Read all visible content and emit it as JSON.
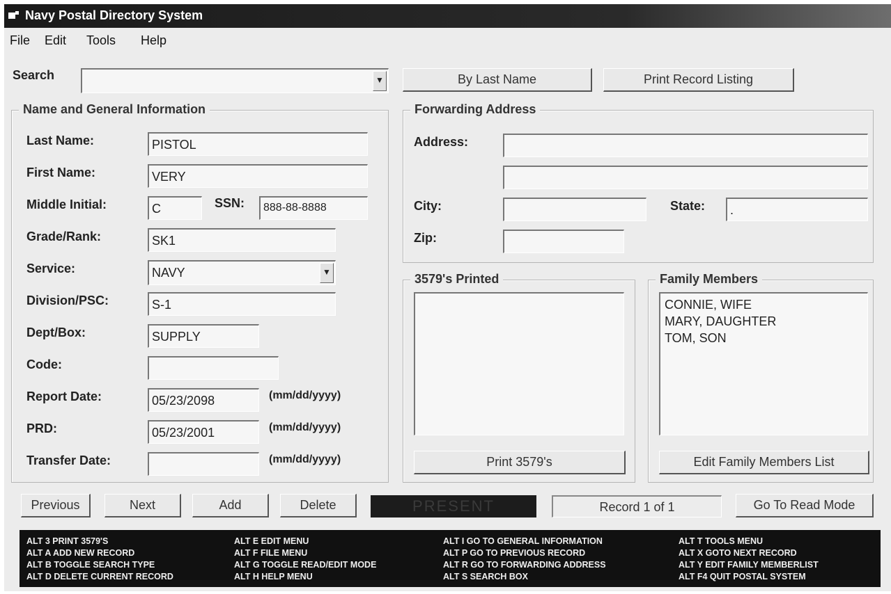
{
  "window": {
    "title": "Navy Postal Directory System"
  },
  "menu": {
    "file": "File",
    "edit": "Edit",
    "tools": "Tools",
    "help": "Help"
  },
  "search": {
    "label": "Search",
    "value": "",
    "by_last_name": "By Last Name",
    "print_listing": "Print Record Listing"
  },
  "general": {
    "title": "Name and General Information",
    "last_name_label": "Last Name:",
    "last_name": "PISTOL",
    "first_name_label": "First Name:",
    "first_name": "VERY",
    "middle_initial_label": "Middle Initial:",
    "middle_initial": "C",
    "ssn_label": "SSN:",
    "ssn": "888-88-8888",
    "grade_label": "Grade/Rank:",
    "grade": "SK1",
    "service_label": "Service:",
    "service": "NAVY",
    "division_label": "Division/PSC:",
    "division": "S-1",
    "dept_label": "Dept/Box:",
    "dept": "SUPPLY",
    "code_label": "Code:",
    "code": "",
    "report_date_label": "Report Date:",
    "report_date": "05/23/2098",
    "prd_label": "PRD:",
    "prd": "05/23/2001",
    "transfer_date_label": "Transfer Date:",
    "transfer_date": "",
    "date_format": "(mm/dd/yyyy)"
  },
  "forwarding": {
    "title": "Forwarding Address",
    "address_label": "Address:",
    "address1": "",
    "address2": "",
    "city_label": "City:",
    "city": "",
    "state_label": "State:",
    "state": ".",
    "zip_label": "Zip:",
    "zip": ""
  },
  "printed": {
    "title": "3579's Printed",
    "items": [],
    "button": "Print 3579's"
  },
  "family": {
    "title": "Family Members",
    "items": [
      "CONNIE, WIFE",
      "MARY, DAUGHTER",
      "TOM, SON"
    ],
    "button": "Edit Family Members List"
  },
  "nav": {
    "previous": "Previous",
    "next": "Next",
    "add": "Add",
    "delete": "Delete",
    "present": "PRESENT",
    "record": "Record 1 of 1",
    "read_mode": "Go To Read Mode"
  },
  "shortcuts": [
    [
      "ALT 3  PRINT 3579'S",
      "ALT A  ADD NEW RECORD",
      "ALT B  TOGGLE SEARCH TYPE",
      "ALT D  DELETE CURRENT RECORD"
    ],
    [
      "ALT E  EDIT MENU",
      "ALT F  FILE MENU",
      "ALT G  TOGGLE READ/EDIT MODE",
      "ALT H  HELP MENU"
    ],
    [
      "ALT I  GO TO GENERAL INFORMATION",
      "ALT P  GO TO PREVIOUS RECORD",
      "ALT R  GO TO FORWARDING ADDRESS",
      "ALT S  SEARCH BOX"
    ],
    [
      "ALT T  TOOLS MENU",
      "ALT X  GOTO NEXT RECORD",
      "ALT Y  EDIT FAMILY MEMBERLIST",
      "ALT F4  QUIT POSTAL SYSTEM"
    ]
  ]
}
